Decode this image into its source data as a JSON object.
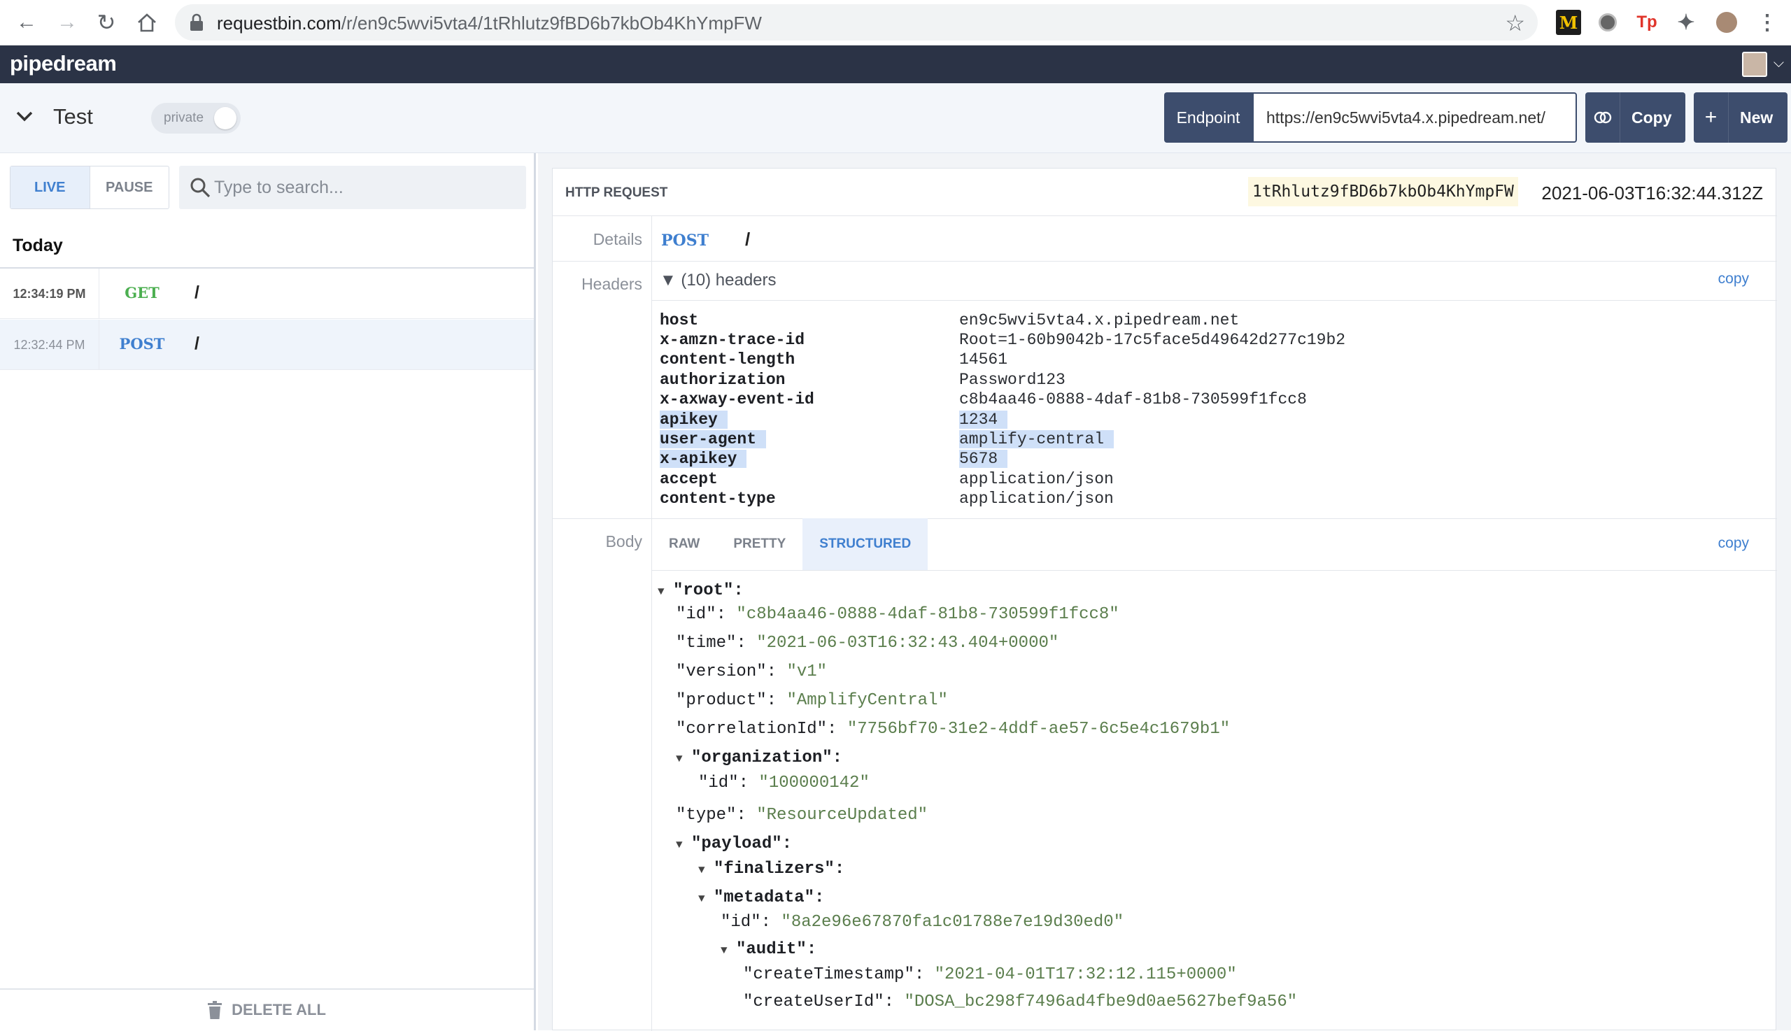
{
  "browser": {
    "url_host": "requestbin.com",
    "url_path": "/r/en9c5wvi5vta4/1tRhlutz9fBD6b7kbOb4KhYmpFW"
  },
  "app": {
    "logo": "pipedream"
  },
  "bin": {
    "name": "Test",
    "privacy": "private",
    "endpoint_label": "Endpoint",
    "endpoint_url": "https://en9c5wvi5vta4.x.pipedream.net/",
    "copy_label": "Copy",
    "new_label": "New"
  },
  "sidebar": {
    "live": "LIVE",
    "pause": "PAUSE",
    "search_placeholder": "Type to search...",
    "group": "Today",
    "events": [
      {
        "time": "12:34:19 PM",
        "method": "GET",
        "path": "/"
      },
      {
        "time": "12:32:44 PM",
        "method": "POST",
        "path": "/"
      }
    ],
    "delete_all": "DELETE ALL"
  },
  "request": {
    "title": "HTTP REQUEST",
    "id": "1tRhlutz9fBD6b7kbOb4KhYmpFW",
    "timestamp": "2021-06-03T16:32:44.312Z",
    "details_label": "Details",
    "method": "POST",
    "path": "/",
    "headers_label": "Headers",
    "headers_toggle": "▼ (10) headers",
    "copy": "copy",
    "headers": [
      {
        "key": "host",
        "value": "en9c5wvi5vta4.x.pipedream.net"
      },
      {
        "key": "x-amzn-trace-id",
        "value": "Root=1-60b9042b-17c5face5d49642d277c19b2"
      },
      {
        "key": "content-length",
        "value": "14561"
      },
      {
        "key": "authorization",
        "value": "Password123"
      },
      {
        "key": "x-axway-event-id",
        "value": "c8b4aa46-0888-4daf-81b8-730599f1fcc8"
      },
      {
        "key": "apikey",
        "value": "1234"
      },
      {
        "key": "user-agent",
        "value": "amplify-central"
      },
      {
        "key": "x-apikey",
        "value": "5678"
      },
      {
        "key": "accept",
        "value": "application/json"
      },
      {
        "key": "content-type",
        "value": "application/json"
      }
    ],
    "body_label": "Body",
    "body_tabs": [
      "RAW",
      "PRETTY",
      "STRUCTURED"
    ],
    "body_active_tab": "STRUCTURED"
  },
  "json_tree": [
    {
      "key": "\"root\":",
      "value": ""
    },
    {
      "key": "\"id\": ",
      "value": "\"c8b4aa46-0888-4daf-81b8-730599f1fcc8\""
    },
    {
      "key": "\"time\": ",
      "value": "\"2021-06-03T16:32:43.404+0000\""
    },
    {
      "key": "\"version\": ",
      "value": "\"v1\""
    },
    {
      "key": "\"product\": ",
      "value": "\"AmplifyCentral\""
    },
    {
      "key": "\"correlationId\": ",
      "value": "\"7756bf70-31e2-4ddf-ae57-6c5e4c1679b1\""
    },
    {
      "key": "\"organization\":",
      "value": ""
    },
    {
      "key": "\"id\": ",
      "value": "\"100000142\""
    },
    {
      "key": "\"type\": ",
      "value": "\"ResourceUpdated\""
    },
    {
      "key": "\"payload\":",
      "value": ""
    },
    {
      "key": "\"finalizers\":",
      "value": ""
    },
    {
      "key": "\"metadata\":",
      "value": ""
    },
    {
      "key": "\"id\": ",
      "value": "\"8a2e96e67870fa1c01788e7e19d30ed0\""
    },
    {
      "key": "\"audit\":",
      "value": ""
    },
    {
      "key": "\"createTimestamp\": ",
      "value": "\"2021-04-01T17:32:12.115+0000\""
    },
    {
      "key": "\"createUserId\": ",
      "value": "\"DOSA_bc298f7496ad4fbe9d0ae5627bef9a56\""
    }
  ],
  "colors": {
    "header_bg": "#2b3346",
    "accent_blue": "#3f7fcf",
    "get_green": "#4caf50",
    "button_dark": "#3d4d6d",
    "selection": "#cfe0f8"
  }
}
